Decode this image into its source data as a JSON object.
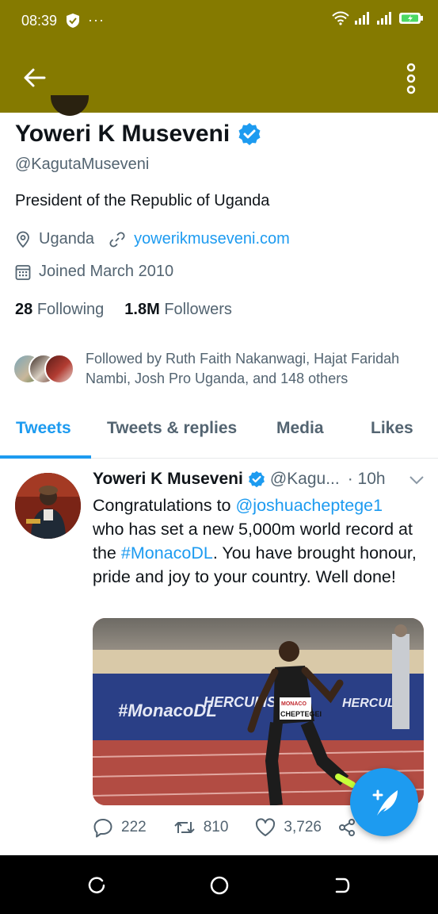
{
  "status_bar": {
    "time": "08:39",
    "overflow": "···"
  },
  "profile": {
    "name": "Yoweri K Museveni",
    "handle": "@KagutaMuseveni",
    "bio": "President of the Republic of Uganda",
    "location": "Uganda",
    "website": "yowerikmuseveni.com",
    "joined": "Joined March 2010",
    "following_count": "28",
    "following_label": "Following",
    "followers_count": "1.8M",
    "followers_label": "Followers",
    "followed_by": "Followed by Ruth Faith Nakanwagi, Hajat Faridah Nambi, Josh Pro Uganda, and 148 others"
  },
  "tabs": [
    {
      "label": "Tweets"
    },
    {
      "label": "Tweets & replies"
    },
    {
      "label": "Media"
    },
    {
      "label": "Likes"
    }
  ],
  "tweet": {
    "name": "Yoweri K Museveni",
    "handle": "@Kagu...",
    "time": "· 10h",
    "text_1": "Congratulations to ",
    "mention": "@joshuacheptege1",
    "text_2": " who has set a new 5,000m world record at the ",
    "hashtag": "#MonacoDL",
    "text_3": ". You have brought honour, pride and joy to your country. Well done!",
    "media_signage": "#MonacoDL",
    "media_signage_2": "HERCULIS",
    "media_bib": "CHEPTEGEI",
    "media_bib_top": "MONACO",
    "replies": "222",
    "retweets": "810",
    "likes": "3,726"
  },
  "colors": {
    "header": "#857a00",
    "accent": "#1d9bf0",
    "muted": "#536471",
    "track": "#b5524a"
  },
  "icons": [
    "arrow-back-icon",
    "more-vert-icon",
    "verified-icon",
    "location-icon",
    "link-icon",
    "calendar-icon",
    "reply-icon",
    "retweet-icon",
    "like-icon",
    "share-icon",
    "compose-icon",
    "chevron-down-icon"
  ]
}
